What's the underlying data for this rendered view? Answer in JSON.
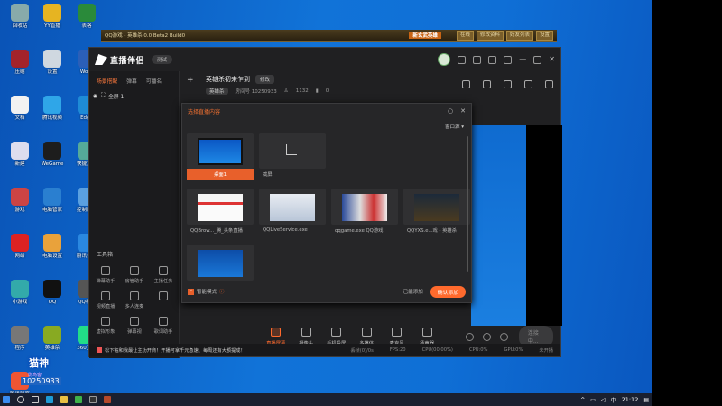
{
  "game_bar": {
    "title": "QQ游戏 - 英雄杀 0.0 Beta2 Build0",
    "highlight": "新玄武英雄",
    "buttons": [
      "在线",
      "修改资料",
      "好友列表",
      "设置"
    ]
  },
  "app": {
    "name": "直播伴侣",
    "version": "测试"
  },
  "left": {
    "tabs": [
      "场景搭配",
      "弹幕",
      "可播名"
    ],
    "scene": "全屏 1",
    "tools_title": "工具箱",
    "tools": [
      {
        "label": "弹幕助手",
        "icon": "danmaku-icon"
      },
      {
        "label": "房管助手",
        "icon": "admin-icon"
      },
      {
        "label": "主播任务",
        "icon": "task-icon"
      },
      {
        "label": "视频直播",
        "icon": "video-icon"
      },
      {
        "label": "多人连麦",
        "icon": "connect-icon"
      },
      {
        "label": "",
        "icon": "blank-icon"
      },
      {
        "label": "虚拟形象",
        "icon": "avatar-icon"
      },
      {
        "label": "弹幕视",
        "icon": "danmaku-view-icon"
      },
      {
        "label": "歌词助手",
        "icon": "lyrics-icon"
      }
    ]
  },
  "room": {
    "title": "英雄杀初来乍到",
    "change_label": "修改",
    "tag": "英雄杀",
    "room_id": "房间号 10250933",
    "viewers": "1132",
    "likes": "0"
  },
  "modal": {
    "title": "选择直播内容",
    "window_source": "窗口源",
    "cards": [
      {
        "label": "桌面1",
        "selected": true,
        "thumb": "desktop"
      },
      {
        "label": "截屏",
        "selected": false,
        "thumb": "crop"
      },
      {
        "label": "",
        "selected": false,
        "thumb": "blank"
      },
      {
        "label": "",
        "selected": false,
        "thumb": "blank"
      },
      {
        "label": "QQBrow..._腾_头条直播",
        "selected": false,
        "thumb": "browser"
      },
      {
        "label": "QQLiveService.exe",
        "selected": false,
        "thumb": "service"
      },
      {
        "label": "qqgame.exe  QQ游戏",
        "selected": false,
        "thumb": "qqgame"
      },
      {
        "label": "QQYXS.e...戏 - 英雄杀",
        "selected": false,
        "thumb": "yxs"
      },
      {
        "label": "",
        "selected": false,
        "thumb": "small"
      }
    ],
    "smart_mode": "智能模式",
    "added": "已能添加",
    "confirm": "确认添加"
  },
  "bottom": {
    "items": [
      {
        "label": "直播屏幕",
        "active": true
      },
      {
        "label": "摄像头",
        "active": false
      },
      {
        "label": "手机投屏",
        "active": false
      },
      {
        "label": "多媒体",
        "active": false
      },
      {
        "label": "麦克风",
        "active": false
      },
      {
        "label": "扬声器",
        "active": false
      }
    ],
    "go_live": "连接中..."
  },
  "status": {
    "notice": "松下钰和我最让主功开商！开播可拿千元急速、每周还有大额提成！",
    "stats": [
      "丢帧(0)/0s",
      "FPS:20",
      "CPU(00.00%)",
      "CPU:0%",
      "GPU:0%",
      "未开播"
    ]
  },
  "watermark": {
    "brand": "猫神",
    "sub": "影鸟客",
    "uid": "10250933"
  },
  "desktop_icons": [
    "回收站",
    "YY直播",
    "表格",
    "压缩",
    "设置",
    "Word",
    "文档",
    "腾讯视频",
    "Edge",
    "新建",
    "WeGame",
    "快捷方式",
    "游戏",
    "电脑管家",
    "控制面板",
    "网络",
    "电脑设置",
    "腾讯会议",
    "小游戏",
    "QQ",
    "QQ视频",
    "程序",
    "英雄杀",
    "360卫士",
    "腾讯管家"
  ],
  "taskbar": {
    "time": "21:12",
    "lang": "中"
  }
}
